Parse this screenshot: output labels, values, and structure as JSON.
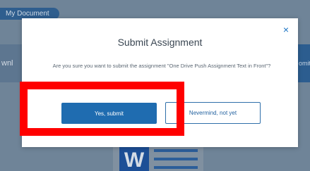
{
  "background": {
    "pill_label": "My Document",
    "left_band_text": "wnl",
    "right_band_text": "omit",
    "doc_icon_letter": "W"
  },
  "modal": {
    "title": "Submit Assignment",
    "message": "Are you sure you want to submit the assignment \"One Drive Push Assignment Text in Front\"?",
    "close_icon": "×",
    "submit_label": "Yes, submit",
    "cancel_label": "Nevermind, not yet"
  },
  "colors": {
    "overlay": "#6f8498",
    "primary": "#1f6cb0",
    "highlight": "#ff0000"
  }
}
